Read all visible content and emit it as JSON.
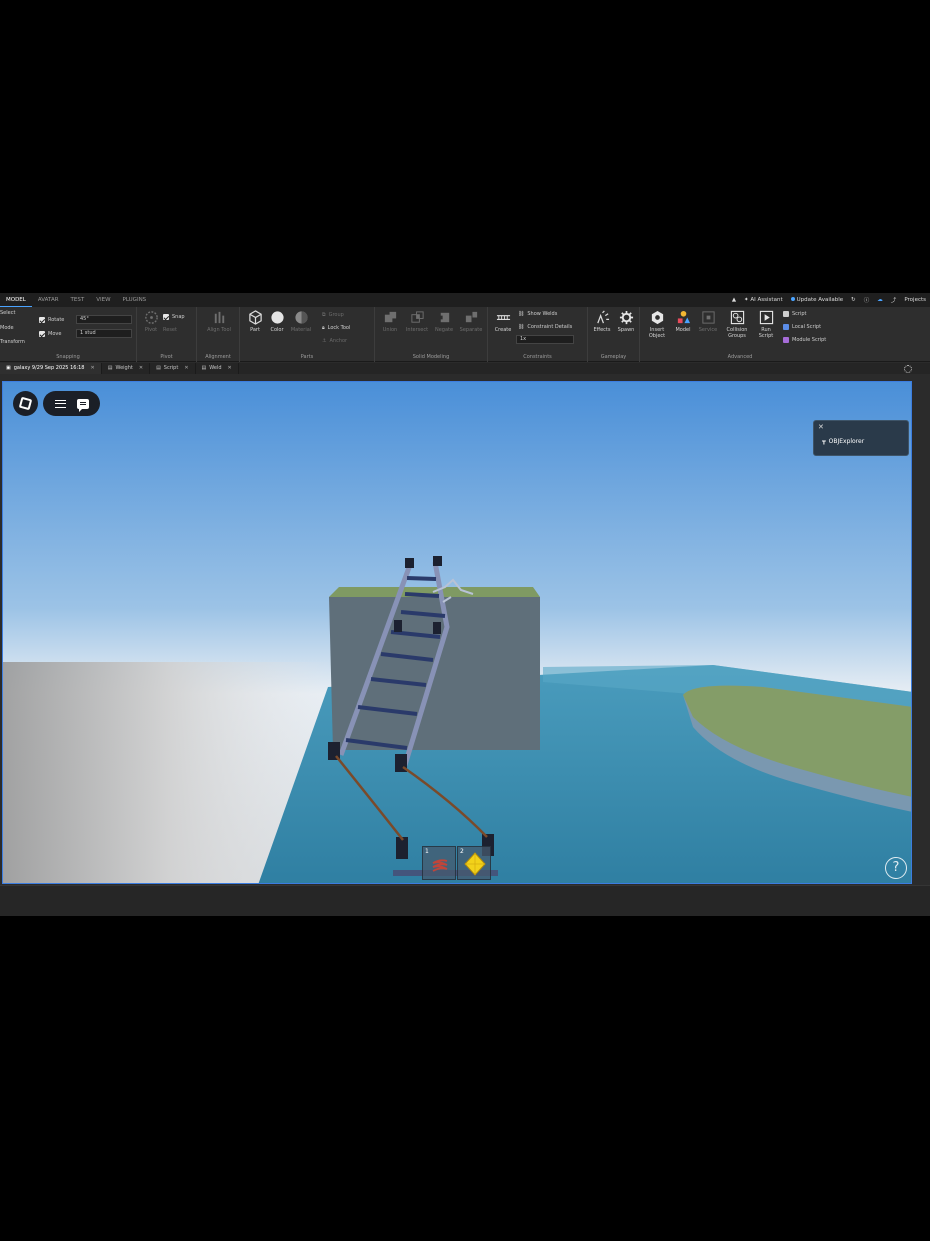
{
  "menubar": {
    "tabs": [
      "MODEL",
      "AVATAR",
      "TEST",
      "VIEW",
      "PLUGINS"
    ],
    "active_tab": "MODEL",
    "ai_assistant": "AI Assistant",
    "update": "Update Available",
    "project": "Projects"
  },
  "ribbon": {
    "snapping": {
      "title": "Snapping",
      "select_label": "Select",
      "mode_label": "Mode",
      "rotate_label": "Rotate",
      "rotate_value": "45°",
      "move_label": "Move",
      "move_value": "1 stud",
      "transform_label": "Transform"
    },
    "pivot": {
      "title": "Pivot",
      "snap_label": "Snap",
      "reset_label": "Reset",
      "pivot_label": "Pivot"
    },
    "alignment": {
      "title": "Alignment",
      "align_label": "Align Tool"
    },
    "parts": {
      "title": "Parts",
      "part_label": "Part",
      "color_label": "Color",
      "material_label": "Material",
      "group_label": "Group",
      "lock_label": "Lock Tool",
      "anchor_label": "Anchor"
    },
    "solid_modeling": {
      "title": "Solid Modeling",
      "union_label": "Union",
      "intersect_label": "Intersect",
      "negate_label": "Negate",
      "separate_label": "Separate"
    },
    "constraints": {
      "title": "Constraints",
      "create_label": "Create",
      "show_welds": "Show Welds",
      "constraint_details": "Constraint Details",
      "scale_value": "1x"
    },
    "gameplay": {
      "title": "Gameplay",
      "effects_label": "Effects",
      "spawn_label": "Spawn"
    },
    "advanced": {
      "title": "Advanced",
      "insert_object_label": "Insert Object",
      "model_label": "Model",
      "service_label": "Service",
      "collision_groups_label": "Collision Groups",
      "run_script_label": "Run Script",
      "script_label": "Script",
      "local_script_label": "Local Script",
      "module_script_label": "Module Script"
    }
  },
  "doc_tabs": [
    {
      "label": "galaxy 9/29 Sep 2025 16:18",
      "active": true
    },
    {
      "label": "Weight",
      "active": false
    },
    {
      "label": "Script",
      "active": false
    },
    {
      "label": "Weld",
      "active": false
    }
  ],
  "viewport": {
    "popup_text": "OBJExplorer",
    "hotbar": [
      {
        "slot": "1",
        "item": "spring-icon"
      },
      {
        "slot": "2",
        "item": "gem-icon"
      }
    ],
    "help_label": "?"
  },
  "colors": {
    "sky_top": "#4a8fd8",
    "sky_horizon": "#e8eef4",
    "water": "#3a8cad",
    "block": "#5d6d78",
    "grass": "#7a9a5e",
    "ladder": "#8a95b4",
    "accent": "#4aa3ff"
  }
}
